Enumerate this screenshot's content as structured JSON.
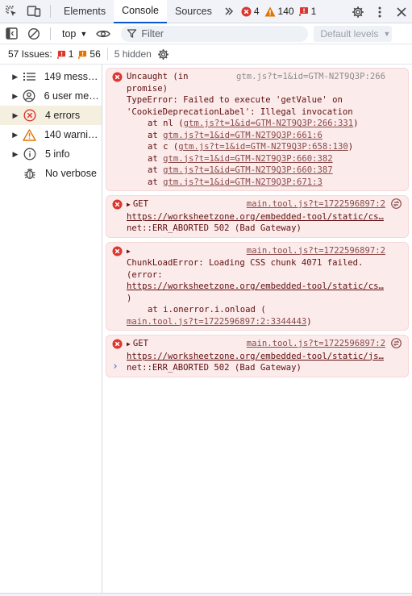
{
  "tabbar": {
    "tabs": [
      "Elements",
      "Console",
      "Sources"
    ],
    "active_tab": "Console",
    "errors_count": "4",
    "warnings_count": "140",
    "issues_count": "1"
  },
  "toolbar": {
    "context": "top",
    "filter_placeholder": "Filter",
    "levels": "Default levels"
  },
  "issues": {
    "label": "57 Issues:",
    "error_issues": "1",
    "other_issues": "56",
    "hidden": "5 hidden"
  },
  "sidebar": {
    "items": [
      {
        "label": "149 messa…",
        "icon": "list-icon"
      },
      {
        "label": "6 user mes…",
        "icon": "user-icon"
      },
      {
        "label": "4 errors",
        "icon": "error-icon"
      },
      {
        "label": "140 warnin…",
        "icon": "warning-icon"
      },
      {
        "label": "5 info",
        "icon": "info-icon"
      },
      {
        "label": "No verbose",
        "icon": "bug-icon"
      }
    ]
  },
  "messages": [
    {
      "source": "gtm.js?t=1&id=GTM-N2T9Q3P:266",
      "lines": [
        "Uncaught (in",
        "promise)",
        "TypeError: Failed to execute 'getValue' on",
        "'CookieDeprecationLabel': Illegal invocation"
      ],
      "stack": [
        {
          "prefix": "at nl (",
          "link": "gtm.js?t=1&id=GTM-N2T9Q3P:266:331",
          "suffix": ")"
        },
        {
          "prefix": "at ",
          "link": "gtm.js?t=1&id=GTM-N2T9Q3P:661:6",
          "suffix": ""
        },
        {
          "prefix": "at c (",
          "link": "gtm.js?t=1&id=GTM-N2T9Q3P:658:130",
          "suffix": ")"
        },
        {
          "prefix": "at ",
          "link": "gtm.js?t=1&id=GTM-N2T9Q3P:660:382",
          "suffix": ""
        },
        {
          "prefix": "at ",
          "link": "gtm.js?t=1&id=GTM-N2T9Q3P:660:387",
          "suffix": ""
        },
        {
          "prefix": "at ",
          "link": "gtm.js?t=1&id=GTM-N2T9Q3P:671:3",
          "suffix": ""
        }
      ]
    },
    {
      "method": "GET",
      "source": "main.tool.js?t=1722596897:2",
      "url": "https://worksheetzone.org/embedded-tool/static/cs…",
      "error": "net::ERR_ABORTED 502 (Bad Gateway)"
    },
    {
      "source": "main.tool.js?t=1722596897:2",
      "lines": [
        "ChunkLoadError: Loading CSS chunk 4071 failed.",
        "(error:"
      ],
      "url": "https://worksheetzone.org/embedded-tool/static/cs…",
      "close": ")",
      "at_line": "at i.onerror.i.onload (",
      "at_link": "main.tool.js?t=1722596897:2:3344443",
      "at_suffix": ")"
    },
    {
      "method": "GET",
      "source": "main.tool.js?t=1722596897:2",
      "url": "https://worksheetzone.org/embedded-tool/static/js…",
      "error": "net::ERR_ABORTED 502 (Bad Gateway)"
    }
  ],
  "prompt": "›",
  "colors": {
    "error_bg": "#fcebeb",
    "error_text": "#5f0f0f",
    "accent": "#0b57d0",
    "error_icon": "#dc362e",
    "warning_icon": "#e37400"
  }
}
